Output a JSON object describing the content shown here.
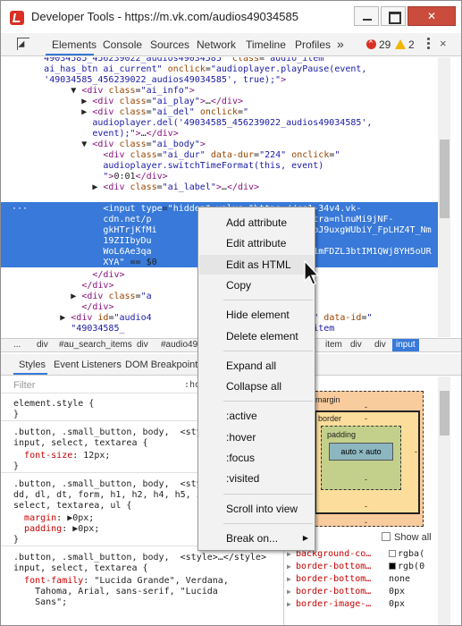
{
  "window": {
    "title": "Developer Tools - https://m.vk.com/audios49034585",
    "close_glyph": "✕"
  },
  "tabs": [
    "Elements",
    "Console",
    "Sources",
    "Network",
    "Timeline",
    "Profiles"
  ],
  "more_tabs": "»",
  "errors": "29",
  "warnings": "2",
  "close_devtools": "×",
  "dom_lines": [
    {
      "indent": "        ",
      "html": "<span class='val'>49034585_456239022_audios49034585\"</span> <span class='attr'>class</span>=<span class='val'>\"audio_item</span>"
    },
    {
      "indent": "        ",
      "html": "<span class='val'>ai_has_btn ai_current\"</span> <span class='attr'>onclick</span>=<span class='val'>\"audioplayer.playPause(event,</span>"
    },
    {
      "indent": "        ",
      "html": "<span class='val'>'49034585_456239022_audios49034585', true);\"</span><span class='tag'>&gt;</span>"
    },
    {
      "indent": "             ▼ ",
      "html": "<span class='tag'>&lt;div</span> <span class='attr'>class</span>=<span class='val'>\"ai_info\"</span><span class='tag'>&gt;</span>"
    },
    {
      "indent": "               ▶ ",
      "html": "<span class='tag'>&lt;div</span> <span class='attr'>class</span>=<span class='val'>\"ai_play\"</span><span class='tag'>&gt;</span>…<span class='tag'>&lt;/div&gt;</span>"
    },
    {
      "indent": "               ▶ ",
      "html": "<span class='tag'>&lt;div</span> <span class='attr'>class</span>=<span class='val'>\"ai_del\"</span> <span class='attr'>onclick</span>=<span class='val'>\"</span>"
    },
    {
      "indent": "                 ",
      "html": "<span class='val'>audioplayer.del('49034585_456239022_audios49034585',</span>"
    },
    {
      "indent": "                 ",
      "html": "<span class='val'>event);\"</span><span class='tag'>&gt;</span>…<span class='tag'>&lt;/div&gt;</span>"
    },
    {
      "indent": "               ▼ ",
      "html": "<span class='tag'>&lt;div</span> <span class='attr'>class</span>=<span class='val'>\"ai_body\"</span><span class='tag'>&gt;</span>"
    },
    {
      "indent": "                   ",
      "html": "<span class='tag'>&lt;div</span> <span class='attr'>class</span>=<span class='val'>\"ai_dur\"</span> <span class='attr'>data-dur</span>=<span class='val'>\"224\"</span> <span class='attr'>onclick</span>=<span class='val'>\"</span>"
    },
    {
      "indent": "                   ",
      "html": "<span class='val'>audioplayer.switchTimeFormat(this, event)</span>"
    },
    {
      "indent": "                   ",
      "html": "<span class='val'>\"</span><span class='tag'>&gt;</span><span class='txt'>0:01</span><span class='tag'>&lt;/div&gt;</span>"
    },
    {
      "indent": "                 ▶ ",
      "html": "<span class='tag'>&lt;div</span> <span class='attr'>class</span>=<span class='val'>\"ai_label\"</span><span class='tag'>&gt;</span>…<span class='tag'>&lt;/div&gt;</span>"
    }
  ],
  "dom_selected": [
    {
      "indent": "                   ",
      "html": "<span class='tag'>&lt;input</span> <span class='attr'>type</span>=<span class='val'>\"hidden\"</span> <span class='attr'>value</span>=<span class='val'>\"https://cs1-34v4.vk-</span>"
    },
    {
      "indent": "                   ",
      "html": "<span class='val'>cdn.net/p                              tra=nlnuMi9jNF-</span>"
    },
    {
      "indent": "                   ",
      "html": "<span class='val'>gkHTrjKfMi                             pJ9uxgWUbiY_FpLHZ4T_Nm</span>"
    },
    {
      "indent": "                   ",
      "html": "<span class='val'>19ZIIbyDu                              </span>"
    },
    {
      "indent": "                   ",
      "html": "<span class='val'>WoL6Ae3qa                              1mFDZL3btIM1QWj8YH5oUR</span>"
    },
    {
      "indent": "                   ",
      "html": "<span class='val'>XYA\"</span> == $0"
    }
  ],
  "dom_lines_after": [
    {
      "indent": "                 ",
      "html": "<span class='tag'>&lt;/div&gt;</span>"
    },
    {
      "indent": "               ",
      "html": "<span class='tag'>&lt;/div&gt;</span>"
    },
    {
      "indent": "             ▶ ",
      "html": "<span class='tag'>&lt;div</span> <span class='attr'>class</span>=<span class='val'>\"a</span>"
    },
    {
      "indent": "               ",
      "html": "<span class='tag'>&lt;/div&gt;</span>"
    },
    {
      "indent": "           ▶ ",
      "html": "<span class='tag'>&lt;div</span> <span class='attr'>id</span>=<span class='val'>\"audio4                    os49034585\"</span> <span class='attr'>data-id</span>=<span class='val'>\"</span>"
    },
    {
      "indent": "             ",
      "html": "<span class='val'>\"49034585_                      </span> <span class='attr'>lass</span>=<span class='val'>\"audio_item</span>"
    }
  ],
  "breadcrumbs": [
    "...",
    "div",
    "#au_search_items",
    "div",
    "#audio49",
    "",
    "",
    "",
    "item",
    "div",
    "div",
    "input"
  ],
  "styles_tabs": [
    "Styles",
    "Event Listeners",
    "DOM Breakpoints"
  ],
  "filter_placeholder": "Filter",
  "hov_label": ":ho",
  "styles_rules": [
    {
      "kind": "selector",
      "text": "element.style {"
    },
    {
      "kind": "close",
      "text": "}"
    },
    {
      "kind": "selector",
      "text": ".button, .small_button, body,  <sty"
    },
    {
      "kind": "selector",
      "text": "input, select, textarea {"
    },
    {
      "kind": "prop",
      "name": "font-size",
      "value": "12px;"
    },
    {
      "kind": "close",
      "text": "}"
    },
    {
      "kind": "selector",
      "text": ".button, .small_button, body,  <sty"
    },
    {
      "kind": "selector",
      "text": "dd, dl, dt, form, h1, h2, h4, h5, i"
    },
    {
      "kind": "selector",
      "text": "select, textarea, ul {"
    },
    {
      "kind": "prop",
      "name": "margin",
      "value": "▶0px;"
    },
    {
      "kind": "prop",
      "name": "padding",
      "value": "▶0px;"
    },
    {
      "kind": "close",
      "text": "}"
    },
    {
      "kind": "selector",
      "text": ".button, .small_button, body,  <style>…</style>"
    },
    {
      "kind": "selector",
      "text": "input, select, textarea {"
    },
    {
      "kind": "prop",
      "name": "font-family",
      "value": "\"Lucida Grande\", Verdana,"
    },
    {
      "kind": "cont",
      "text": "    Tahoma, Arial, sans-serif, \"Lucida"
    },
    {
      "kind": "cont",
      "text": "    Sans\";"
    }
  ],
  "box_model": {
    "margin": "margin",
    "border": "border",
    "padding": "padding",
    "content": "auto × auto",
    "dash": "-"
  },
  "show_all": "Show all",
  "computed": [
    {
      "name": "background-co…",
      "value": "rgba(",
      "swatch": "#ffffff"
    },
    {
      "name": "border-bottom…",
      "value": "rgb(0",
      "swatch": "#000000"
    },
    {
      "name": "border-bottom…",
      "value": "none"
    },
    {
      "name": "border-bottom…",
      "value": "0px"
    },
    {
      "name": "border-image-…",
      "value": "0px"
    }
  ],
  "context_menu": [
    {
      "label": "Add attribute"
    },
    {
      "label": "Edit attribute"
    },
    {
      "label": "Edit as HTML",
      "hover": true
    },
    {
      "label": "Copy"
    },
    {
      "sep": true
    },
    {
      "label": "Hide element"
    },
    {
      "label": "Delete element"
    },
    {
      "sep": true
    },
    {
      "label": "Expand all"
    },
    {
      "label": "Collapse all"
    },
    {
      "sep": true
    },
    {
      "label": ":active"
    },
    {
      "label": ":hover"
    },
    {
      "label": ":focus"
    },
    {
      "label": ":visited"
    },
    {
      "sep": true
    },
    {
      "label": "Scroll into view"
    },
    {
      "sep": true
    },
    {
      "label": "Break on...",
      "submenu": true
    }
  ],
  "colors": {
    "selection": "#3879d9",
    "tag": "#881280",
    "attr": "#994500",
    "value": "#1a1aa6",
    "css_prop": "#c80000",
    "close_button": "#c94c3d"
  }
}
